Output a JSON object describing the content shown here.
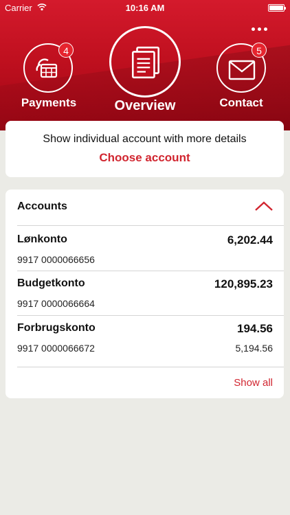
{
  "status_bar": {
    "carrier": "Carrier",
    "time": "10:16 AM"
  },
  "colors": {
    "brand_red": "#c0101f",
    "accent_red": "#d1252f",
    "badge_red": "#e6242e",
    "background": "#ebebe6"
  },
  "nav": {
    "payments": {
      "label": "Payments",
      "badge": "4",
      "icon": "calendar-pay-icon"
    },
    "overview": {
      "label": "Overview",
      "icon": "documents-icon"
    },
    "contact": {
      "label": "Contact",
      "badge": "5",
      "icon": "envelope-icon"
    }
  },
  "choose_card": {
    "description": "Show individual account with more details",
    "action": "Choose account"
  },
  "accounts": {
    "title": "Accounts",
    "items": [
      {
        "name": "Lønkonto",
        "number": "9917 0000066656",
        "balance": "6,202.44",
        "available": ""
      },
      {
        "name": "Budgetkonto",
        "number": "9917 0000066664",
        "balance": "120,895.23",
        "available": ""
      },
      {
        "name": "Forbrugskonto",
        "number": "9917 0000066672",
        "balance": "194.56",
        "available": "5,194.56"
      }
    ],
    "show_all": "Show all"
  }
}
